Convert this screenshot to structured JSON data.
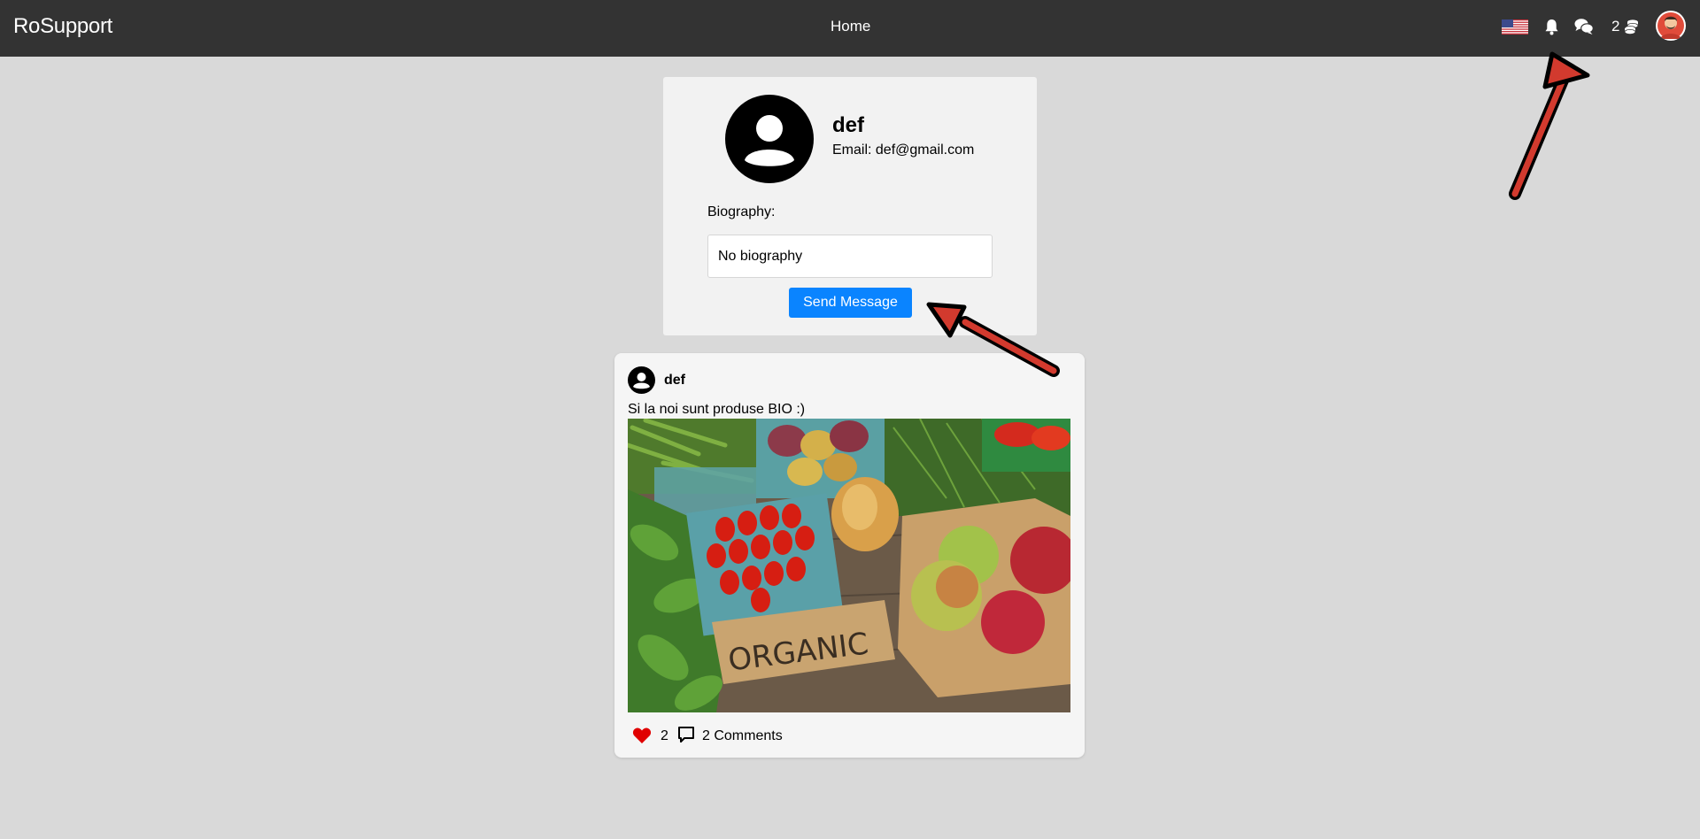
{
  "navbar": {
    "brand": "RoSupport",
    "home_label": "Home",
    "coins_count": "2",
    "icons": [
      "us-flag-icon",
      "bell-icon",
      "chat-icon",
      "coins-icon",
      "user-avatar"
    ],
    "background": "#333333"
  },
  "profile": {
    "name": "def",
    "email": "Email: def@gmail.com",
    "bio_label": "Biography:",
    "bio_value": "No biography",
    "send_button": "Send Message",
    "accent": "#0a84ff"
  },
  "post": {
    "author": "def",
    "text": "Si la noi sunt produse BIO :)",
    "image_sign": "ORGANIC",
    "likes": "2",
    "comments": "2 Comments",
    "like_color": "#e00000"
  },
  "annotations": {
    "arrow_color": "#d23a2e"
  }
}
